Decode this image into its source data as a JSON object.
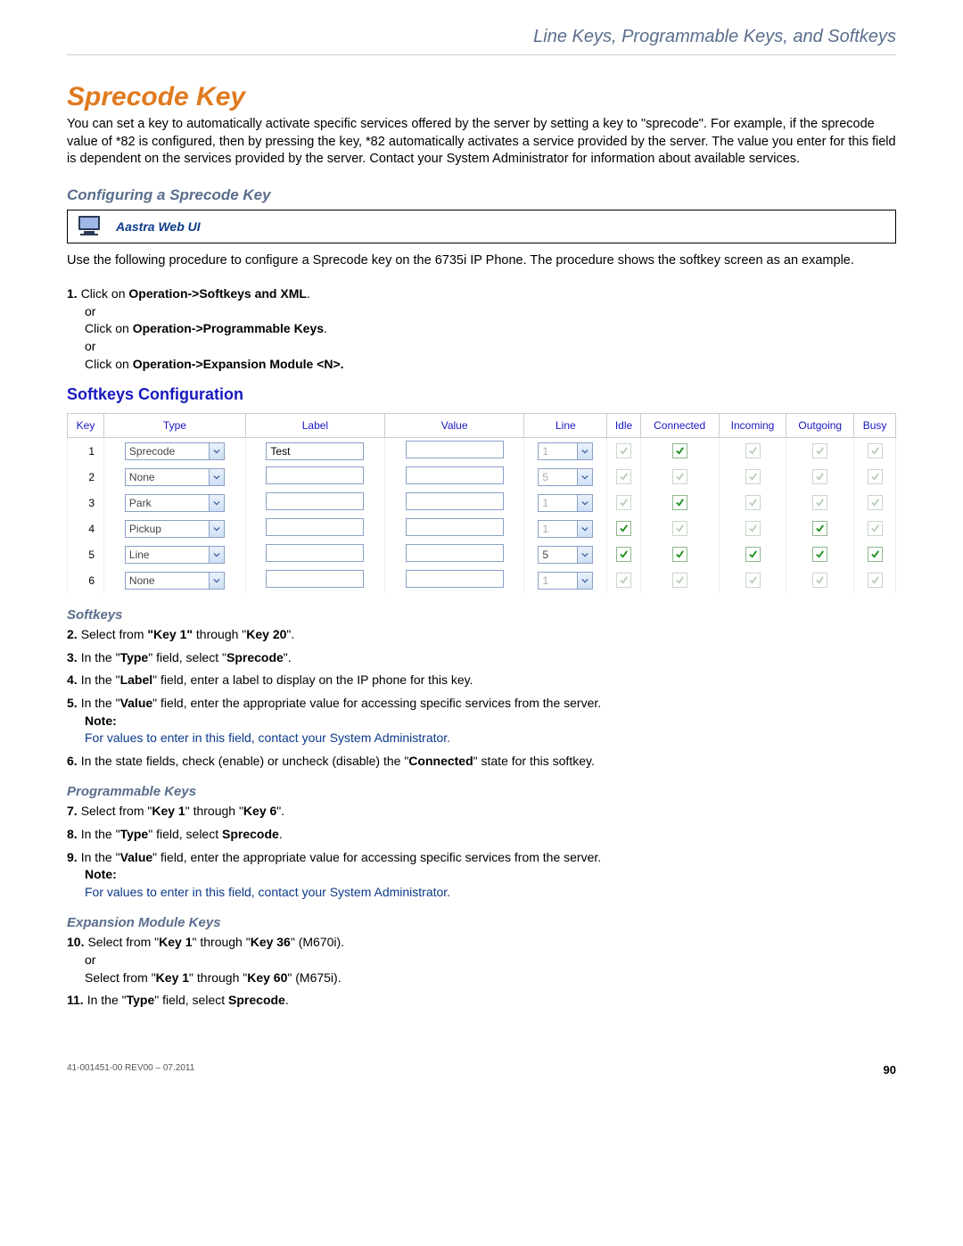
{
  "header": {
    "breadcrumb": "Line Keys, Programmable Keys, and Softkeys"
  },
  "title": "Sprecode Key",
  "intro": "You can set a key to automatically activate specific services offered by the server by setting a key to \"sprecode\". For example, if the sprecode value of *82 is configured, then by pressing the key, *82 automatically activates a service provided by the server. The value you enter for this field is dependent on the services provided by the server. Contact your System Administrator for information about available services.",
  "configuringTitle": "Configuring a Sprecode Key",
  "callout": {
    "label": "Aastra Web UI"
  },
  "useText": "Use the following procedure to configure a Sprecode key on the 6735i IP Phone. The procedure shows the softkey screen as an example.",
  "step1": {
    "num": "1.",
    "a_pre": "Click on ",
    "a_bold": "Operation->Softkeys and XML",
    "a_post": ".",
    "or1": "or",
    "b_pre": "Click on ",
    "b_bold": "Operation->Programmable Keys",
    "b_post": ".",
    "or2": "or",
    "c_pre": "Click on ",
    "c_bold": "Operation->Expansion Module <N>."
  },
  "configScreenshot": {
    "title": "Softkeys Configuration",
    "headers": [
      "Key",
      "Type",
      "Label",
      "Value",
      "Line",
      "Idle",
      "Connected",
      "Incoming",
      "Outgoing",
      "Busy"
    ],
    "rows": [
      {
        "key": "1",
        "type": "Sprecode",
        "label": "Test",
        "value": "",
        "line": "1",
        "lineEnabled": false,
        "states": [
          {
            "on": true,
            "enabled": false
          },
          {
            "on": true,
            "enabled": true
          },
          {
            "on": true,
            "enabled": false
          },
          {
            "on": true,
            "enabled": false
          },
          {
            "on": true,
            "enabled": false
          }
        ]
      },
      {
        "key": "2",
        "type": "None",
        "label": "",
        "value": "",
        "line": "5",
        "lineEnabled": false,
        "states": [
          {
            "on": true,
            "enabled": false
          },
          {
            "on": true,
            "enabled": false
          },
          {
            "on": true,
            "enabled": false
          },
          {
            "on": true,
            "enabled": false
          },
          {
            "on": true,
            "enabled": false
          }
        ]
      },
      {
        "key": "3",
        "type": "Park",
        "label": "",
        "value": "",
        "line": "1",
        "lineEnabled": false,
        "states": [
          {
            "on": true,
            "enabled": false
          },
          {
            "on": true,
            "enabled": true
          },
          {
            "on": true,
            "enabled": false
          },
          {
            "on": true,
            "enabled": false
          },
          {
            "on": true,
            "enabled": false
          }
        ]
      },
      {
        "key": "4",
        "type": "Pickup",
        "label": "",
        "value": "",
        "line": "1",
        "lineEnabled": false,
        "states": [
          {
            "on": true,
            "enabled": true
          },
          {
            "on": true,
            "enabled": false
          },
          {
            "on": true,
            "enabled": false
          },
          {
            "on": true,
            "enabled": true
          },
          {
            "on": true,
            "enabled": false
          }
        ]
      },
      {
        "key": "5",
        "type": "Line",
        "label": "",
        "value": "",
        "line": "5",
        "lineEnabled": true,
        "states": [
          {
            "on": true,
            "enabled": true
          },
          {
            "on": true,
            "enabled": true
          },
          {
            "on": true,
            "enabled": true
          },
          {
            "on": true,
            "enabled": true
          },
          {
            "on": true,
            "enabled": true
          }
        ]
      },
      {
        "key": "6",
        "type": "None",
        "label": "",
        "value": "",
        "line": "1",
        "lineEnabled": false,
        "states": [
          {
            "on": true,
            "enabled": false
          },
          {
            "on": true,
            "enabled": false
          },
          {
            "on": true,
            "enabled": false
          },
          {
            "on": true,
            "enabled": false
          },
          {
            "on": true,
            "enabled": false
          }
        ]
      }
    ]
  },
  "softkeysTitle": "Softkeys",
  "step2": {
    "num": "2.",
    "pre": "Select from ",
    "b1": "\"Key 1\"",
    "mid": " through \"",
    "b2": "Key 20",
    "post": "\"."
  },
  "step3": {
    "num": "3.",
    "pre": "In the \"",
    "b1": "Type",
    "mid": "\" field, select \"",
    "b2": "Sprecode",
    "post": "\"."
  },
  "step4": {
    "num": "4.",
    "pre": "In the \"",
    "b1": "Label",
    "post": "\" field, enter a label to display on the IP phone for this key."
  },
  "step5": {
    "num": "5.",
    "pre": "In the \"",
    "b1": "Value",
    "post": "\" field, enter the appropriate value for accessing specific services from the server.",
    "noteLabel": "Note:",
    "noteText": "For values to enter in this field, contact your System Administrator."
  },
  "step6": {
    "num": "6.",
    "pre": "In the state fields, check (enable) or uncheck (disable) the \"",
    "b1": "Connected",
    "post": "\" state for this softkey."
  },
  "progKeysTitle": "Programmable Keys",
  "step7": {
    "num": "7.",
    "pre": "Select from \"",
    "b1": "Key 1",
    "mid": "\" through \"",
    "b2": "Key 6",
    "post": "\"."
  },
  "step8": {
    "num": "8.",
    "pre": "In the \"",
    "b1": "Type",
    "mid": "\" field, select ",
    "b2": "Sprecode",
    "post": "."
  },
  "step9": {
    "num": "9.",
    "pre": "In the \"",
    "b1": "Value",
    "post": "\" field, enter the appropriate value for accessing specific services from the server.",
    "noteLabel": "Note:",
    "noteText": "For values to enter in this field, contact your System Administrator."
  },
  "expKeysTitle": "Expansion Module Keys",
  "step10": {
    "num": "10.",
    "pre": "Select from \"",
    "b1": "Key 1",
    "mid": "\" through \"",
    "b2": "Key 36",
    "post": "\" (M670i).",
    "or": "or",
    "pre2": "Select from \"",
    "b3": "Key 1",
    "mid2": "\" through \"",
    "b4": "Key 60",
    "post2": "\" (M675i)."
  },
  "step11": {
    "num": "11.",
    "pre": "In the \"",
    "b1": "Type",
    "mid": "\" field, select ",
    "b2": "Sprecode",
    "post": "."
  },
  "footer": {
    "left": "41-001451-00 REV00 – 07.2011",
    "right": "90"
  }
}
